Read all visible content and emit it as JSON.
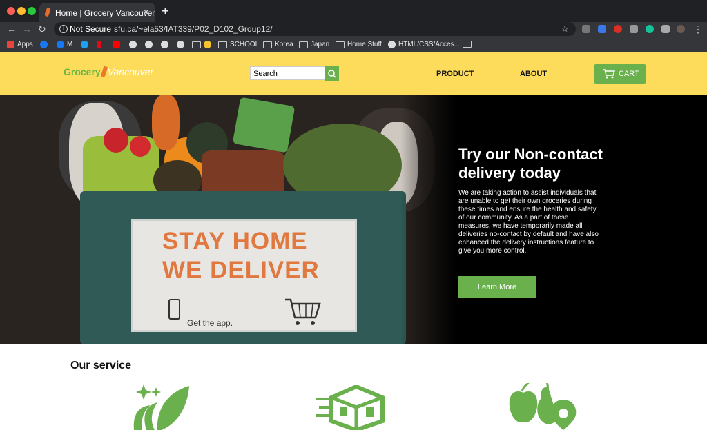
{
  "browser": {
    "tab_title": "Home | Grocery Vancouver",
    "new_tab_glyph": "+",
    "close_glyph": "✕",
    "security_label": "Not Secure",
    "url": "sfu.ca/~ela53/IAT339/P02_D102_Group12/",
    "bookmarks": [
      "Apps",
      "M",
      "SCHOOL",
      "Korea",
      "Japan",
      "Home Stuff",
      "HTML/CSS/Acces..."
    ]
  },
  "site": {
    "logo_grocery": "Grocery",
    "logo_vancouver": "Vancouver",
    "search_placeholder": "Search",
    "nav_product": "PRODUCT",
    "nav_about": "ABOUT",
    "cart_label": "CART"
  },
  "hero": {
    "sign_line1": "STAY HOME",
    "sign_line2": "WE DELIVER",
    "sign_app": "Get the app.",
    "title": "Try our Non-contact delivery today",
    "body": "We are taking action to assist individuals that are unable to get their own groceries during these times and ensure the health and safety of our community. As a part of these measures, we have temporarily made all deliveries no-contact by default and have also enhanced the delivery instructions feature to give you more control.",
    "button": "Learn More"
  },
  "services": {
    "title": "Our service",
    "icons": [
      "fresh-leaf-icon",
      "fast-delivery-box-icon",
      "local-produce-location-icon"
    ]
  },
  "colors": {
    "header_bg": "#fddc5c",
    "accent_green": "#6ab04c",
    "sign_orange": "#e0783f"
  }
}
